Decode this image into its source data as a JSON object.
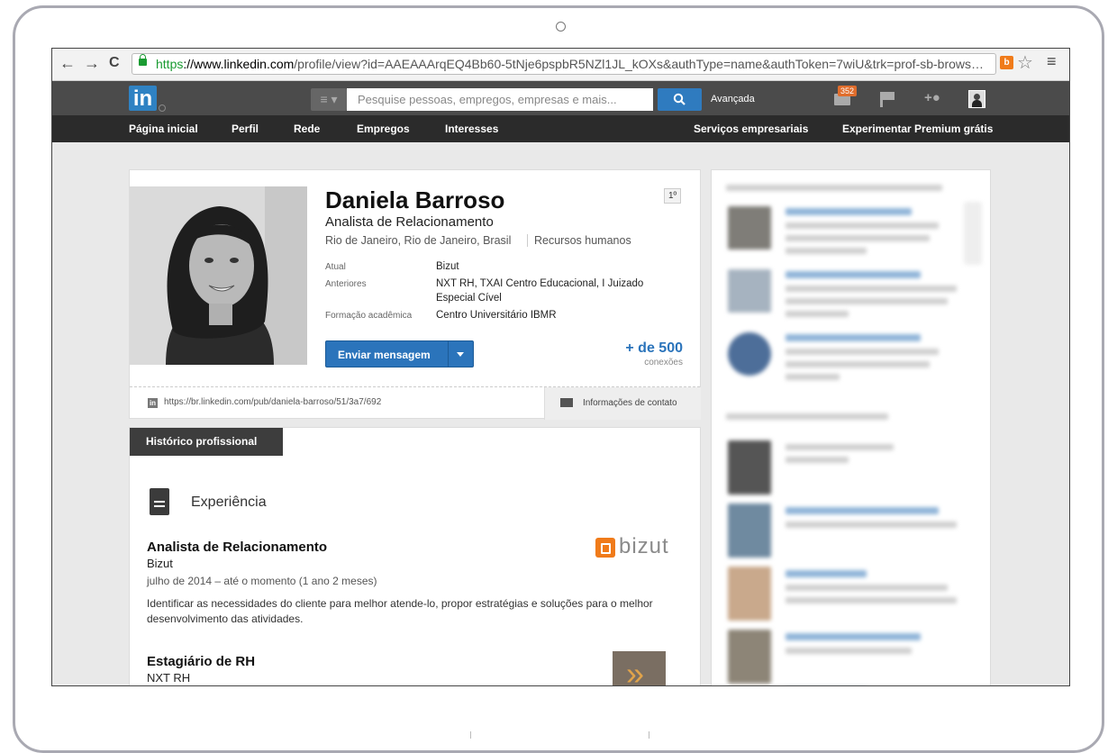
{
  "browser": {
    "back": "←",
    "forward": "→",
    "reload": "C",
    "url_https": "https",
    "url_host": "://www.linkedin.com",
    "url_path": "/profile/view?id=AAEAAArqEQ4Bb60-5tNje6pspbR5NZl1JL_kOXs&authType=name&authToken=7wiU&trk=prof-sb-brows…",
    "ext_label": "b",
    "star": "☆",
    "menu": "≡"
  },
  "header": {
    "logo": "in",
    "search_placeholder": "Pesquise pessoas, empregos, empresas e mais...",
    "advanced": "Avançada",
    "messages_badge": "352"
  },
  "nav": {
    "items": [
      "Página inicial",
      "Perfil",
      "Rede",
      "Empregos",
      "Interesses"
    ],
    "business": "Serviços empresariais",
    "premium": "Experimentar Premium grátis"
  },
  "profile": {
    "name": "Daniela Barroso",
    "headline": "Analista de Relacionamento",
    "location": "Rio de Janeiro, Rio de Janeiro, Brasil",
    "industry": "Recursos humanos",
    "degree": "1º",
    "current_label": "Atual",
    "current_value": "Bizut",
    "previous_label": "Anteriores",
    "previous_value": "NXT RH, TXAI Centro Educacional, I Juizado Especial Cível",
    "education_label": "Formação acadêmica",
    "education_value": "Centro Universitário IBMR",
    "send_button": "Enviar mensagem",
    "connections_count": "+ de 500",
    "connections_label": "conexões",
    "public_url": "https://br.linkedin.com/pub/daniela-barroso/51/3a7/692",
    "contact_info": "Informações de contato"
  },
  "history": {
    "tab": "Histórico profissional",
    "section_title": "Experiência",
    "jobs": [
      {
        "title": "Analista de Relacionamento",
        "company": "Bizut",
        "dates": "julho de 2014 – até o momento (1 ano 2 meses)",
        "description": "Identificar as necessidades do cliente para melhor atende-lo, propor estratégias e soluções para o melhor desenvolvimento das atividades.",
        "logo_text": "bizut"
      },
      {
        "title": "Estagiário de RH",
        "company": "NXT RH"
      }
    ]
  },
  "colors": {
    "linkedin_blue": "#2f82c3",
    "button_blue": "#2b74bb",
    "header_dark": "#4b4b4b",
    "nav_dark": "#2b2b2b",
    "bizut_orange": "#f07b1a"
  }
}
